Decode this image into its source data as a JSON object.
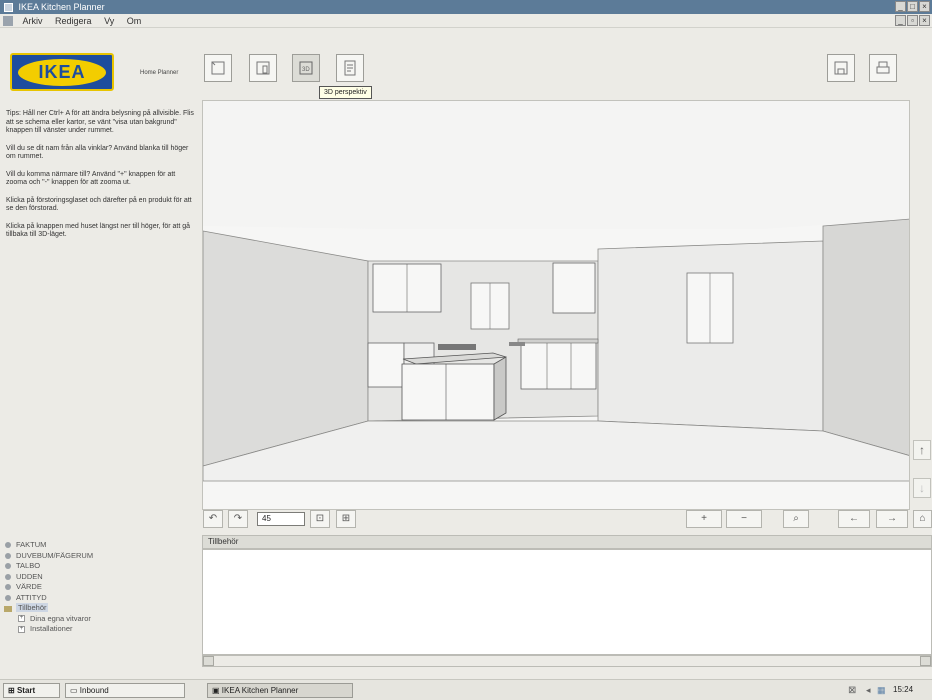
{
  "window": {
    "title": "IKEA Kitchen Planner",
    "menu": [
      "Arkiv",
      "Redigera",
      "Vy",
      "Om"
    ]
  },
  "header": {
    "logo_text": "IKEA",
    "logo_sub": "Home Planner",
    "tooltip": "3D perspektiv"
  },
  "tips": [
    "Tips: Håll ner Ctrl+ A för att ändra belysning på allvisible. Flis att se schema eller kartor, se vänt \"visa utan bakgrund\" knappen till vänster under rummet.",
    "Vill du se dit nam från alla vinklar? Använd blanka till höger om rummet.",
    "Vill du komma närmare till? Använd \"+\" knappen för att zooma och \"-\" knappen för att zooma ut.",
    "Klicka på förstoringsglaset och därefter på en produkt för att se den förstorad.",
    "Klicka på knappen med huset längst ner till höger, för att gå tillbaka till 3D-läget."
  ],
  "toolbar": {
    "zoom_value": "45"
  },
  "tree": {
    "items": [
      {
        "label": "FAKTUM",
        "selected": false
      },
      {
        "label": "DUVEBUM/FÄGERUM",
        "selected": false
      },
      {
        "label": "TALBO",
        "selected": false
      },
      {
        "label": "UDDEN",
        "selected": false
      },
      {
        "label": "VÄRDE",
        "selected": false
      },
      {
        "label": "ATTITYD",
        "selected": false
      },
      {
        "label": "Tillbehör",
        "selected": true
      }
    ],
    "sub_items": [
      "Dina egna vitvaror",
      "Installationer"
    ]
  },
  "description": {
    "header": "Tillbehör"
  },
  "taskbar": {
    "start": "Start",
    "task1": "Inbound",
    "task2": "IKEA Kitchen Planner",
    "clock": "15:24"
  },
  "colors": {
    "titlebar": "#5c7b98",
    "ikea_blue": "#1e4d9e",
    "ikea_yellow": "#f3cd00"
  }
}
